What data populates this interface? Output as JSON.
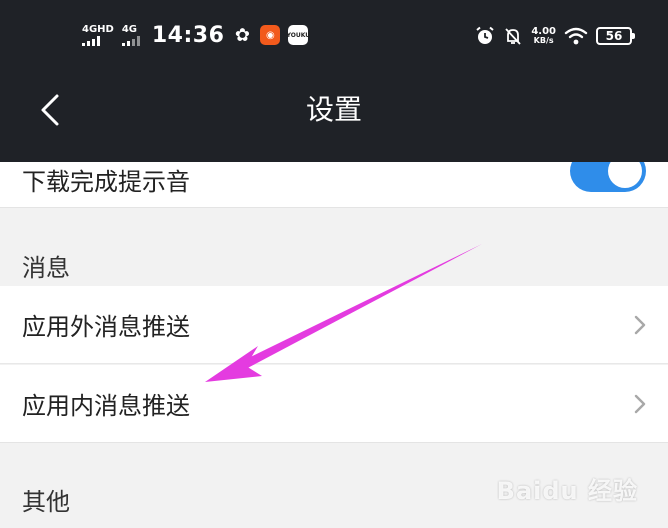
{
  "status_bar": {
    "network1": "4GHD",
    "network2": "4G",
    "time": "14:36",
    "net_speed_value": "4.00",
    "net_speed_unit": "KB/s",
    "battery": "56",
    "icons": [
      "fan-app-icon",
      "orange-app-icon",
      "youku-app-icon",
      "alarm-icon",
      "mute-icon",
      "wifi-icon"
    ]
  },
  "nav": {
    "title": "设置"
  },
  "settings": {
    "download_sound_label": "下载完成提示音",
    "download_sound_on": true,
    "messages_section": "消息",
    "external_push_label": "应用外消息推送",
    "internal_push_label": "应用内消息推送",
    "other_section": "其他"
  },
  "watermark": "Baidu 经验",
  "colors": {
    "header_bg": "#1f2227",
    "toggle_on": "#2f8dea",
    "annotation_arrow": "#e43be0",
    "page_bg": "#f2f2f2"
  }
}
